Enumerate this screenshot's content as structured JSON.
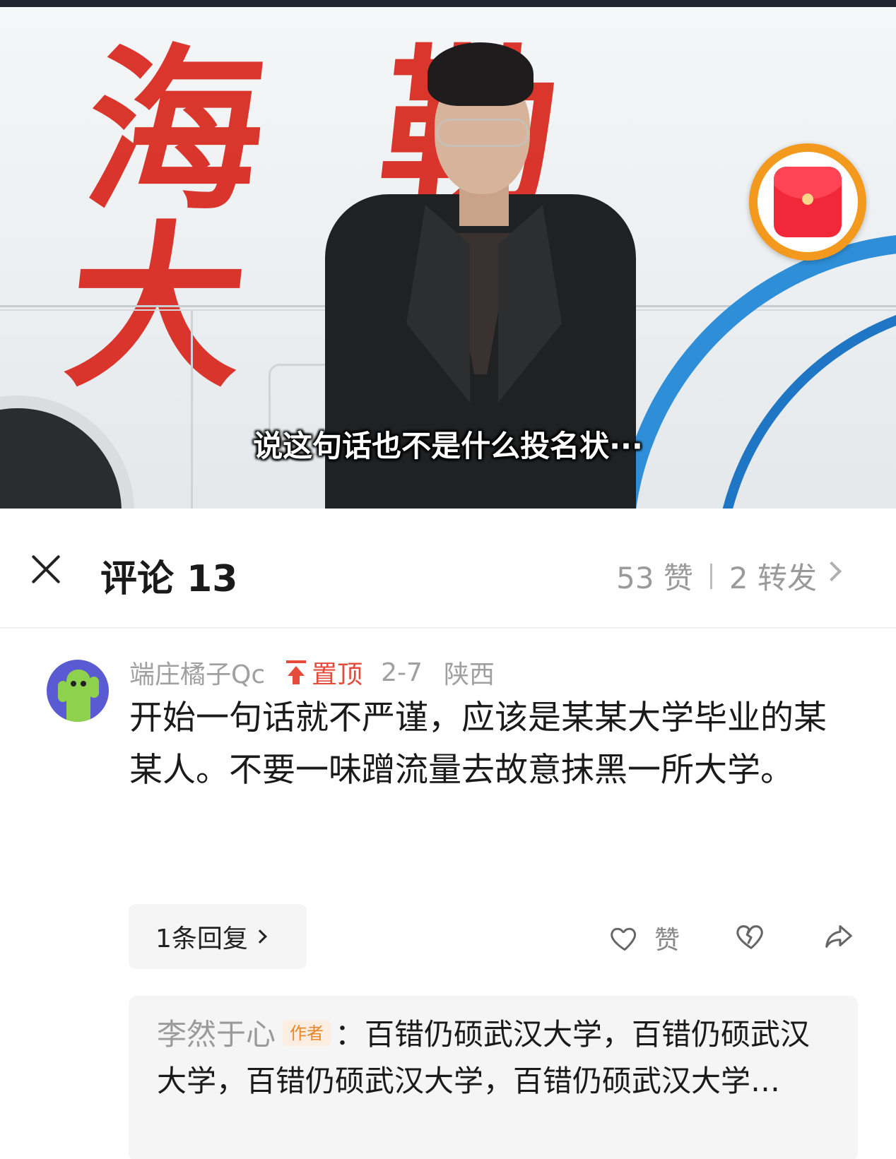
{
  "video": {
    "subtitle": "说这句话也不是什么投名状···",
    "calligraphy": "海 勒 大 等",
    "red_packet_icon": "red-envelope-icon",
    "colors": {
      "calligraphy": "#d8261c",
      "ring": "#f39a1e",
      "stripe": "#2e8fd8"
    }
  },
  "header": {
    "close_icon": "close-icon",
    "title": "评论 13",
    "likes": "53 赞",
    "reposts": "2 转发"
  },
  "comment": {
    "username": "端庄橘子Qc",
    "pinned_label": "置顶",
    "date": "2-7",
    "region": "陕西",
    "text": "开始一句话就不严谨，应该是某某大学毕业的某某人。不要一味蹭流量去故意抹黑一所大学。",
    "reply_count": "1条回复",
    "like_label": "赞"
  },
  "reply": {
    "author": "李然于心",
    "tag": "作者",
    "text": "：百错仍硕武汉大学，百错仍硕武汉大学，百错仍硕武汉大学，百错仍硕武汉大学…"
  },
  "colors": {
    "accent_red": "#e64a3b",
    "muted": "#9a9a9a",
    "author_tag": "#e8862a"
  }
}
